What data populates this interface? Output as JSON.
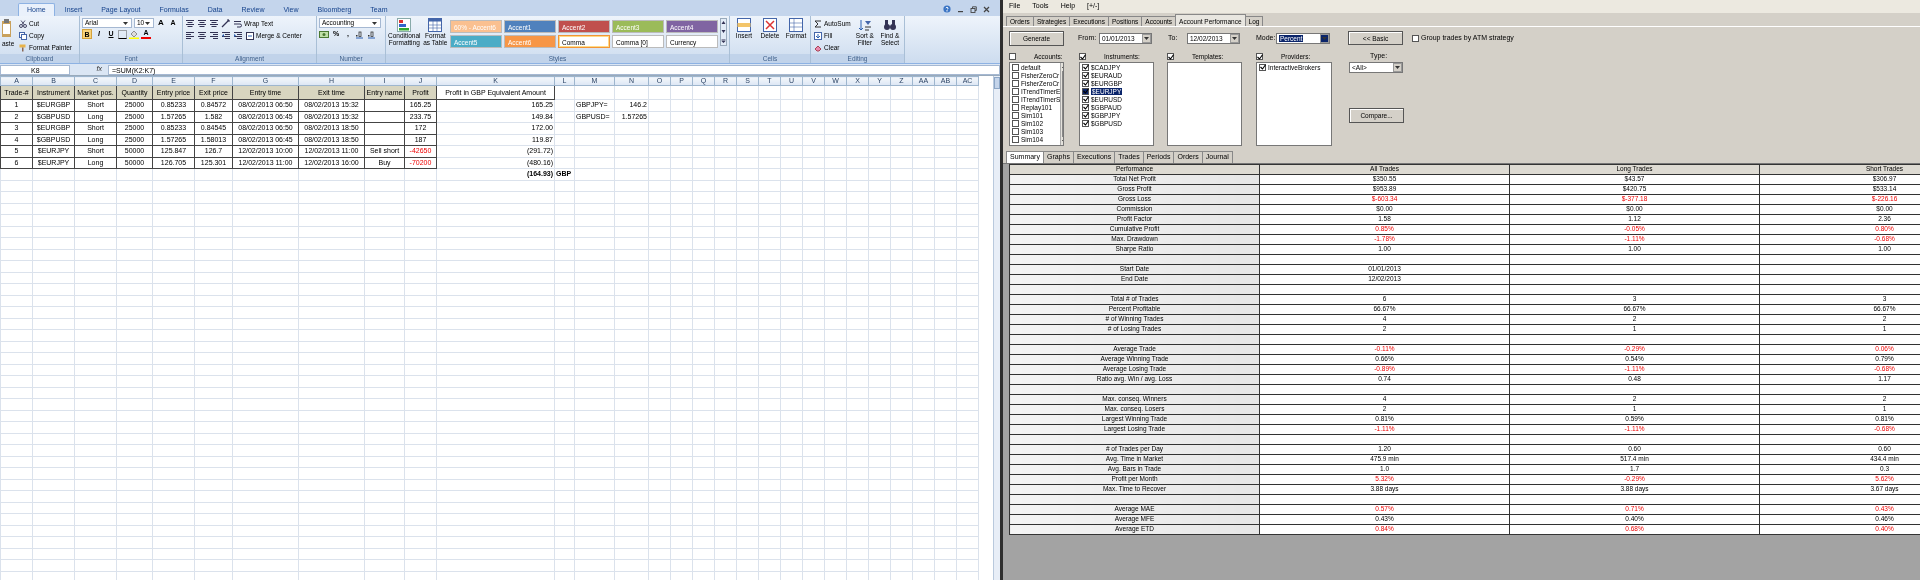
{
  "excel": {
    "ribbon_tabs": [
      {
        "label": "Home",
        "selected": true
      },
      {
        "label": "Insert",
        "selected": false
      },
      {
        "label": "Page Layout",
        "selected": false
      },
      {
        "label": "Formulas",
        "selected": false
      },
      {
        "label": "Data",
        "selected": false
      },
      {
        "label": "Review",
        "selected": false
      },
      {
        "label": "View",
        "selected": false
      },
      {
        "label": "Bloomberg",
        "selected": false
      },
      {
        "label": "Team",
        "selected": false
      }
    ],
    "clipboard": {
      "paste": "aste",
      "cut": "Cut",
      "copy": "Copy",
      "format_painter": "Format Painter",
      "label": "Clipboard"
    },
    "font": {
      "name": "Arial",
      "size": "10",
      "grow": "A",
      "shrink": "A",
      "bold": "B",
      "italic": "I",
      "underline": "U",
      "font_color": "A",
      "label": "Font"
    },
    "alignment": {
      "wrap": "Wrap Text",
      "merge": "Merge & Center",
      "label": "Alignment"
    },
    "number": {
      "format": "Accounting",
      "percent": "%",
      "comma": ",",
      "label": "Number"
    },
    "styles": {
      "conditional": "Conditional Formatting",
      "format_table": "Format as Table",
      "label": "Styles",
      "cells": [
        {
          "label": "60% - Accent6",
          "color": "#fac090",
          "kind": "accent",
          "selected": false
        },
        {
          "label": "Accent1",
          "color": "#4f81bd",
          "kind": "accent",
          "selected": false
        },
        {
          "label": "Accent2",
          "color": "#c0504d",
          "kind": "accent",
          "selected": false
        },
        {
          "label": "Accent3",
          "color": "#9bbb59",
          "kind": "accent",
          "selected": false
        },
        {
          "label": "Accent4",
          "color": "#8064a2",
          "kind": "accent",
          "selected": false
        },
        {
          "label": "Accent5",
          "color": "#4bacc6",
          "kind": "accent",
          "selected": false
        },
        {
          "label": "Accent6",
          "color": "#f79646",
          "kind": "accent",
          "selected": false
        },
        {
          "label": "Comma",
          "color": "#ffffff",
          "kind": "plain",
          "selected": true
        },
        {
          "label": "Comma [0]",
          "color": "#ffffff",
          "kind": "plain",
          "selected": false
        },
        {
          "label": "Currency",
          "color": "#ffffff",
          "kind": "plain",
          "selected": false
        }
      ]
    },
    "cells_group": {
      "buttons": [
        "Insert",
        "Delete",
        "Format"
      ],
      "label": "Cells"
    },
    "editing": {
      "autosum": "AutoSum",
      "fill": "Fill",
      "clear": "Clear",
      "sort": "Sort & Filter",
      "find": "Find & Select",
      "label": "Editing"
    },
    "name_box": "K8",
    "fx": "fx",
    "formula": "=SUM(K2:K7)",
    "columns": [
      "A",
      "B",
      "C",
      "D",
      "E",
      "F",
      "G",
      "H",
      "I",
      "J",
      "K",
      "L",
      "M",
      "N",
      "O",
      "P",
      "Q",
      "R",
      "S",
      "T",
      "U",
      "V",
      "W",
      "X",
      "Y",
      "Z",
      "AA",
      "AB",
      "AC"
    ],
    "trade_headers": [
      "Trade-#",
      "Instrument",
      "Market pos.",
      "Quantity",
      "Entry price",
      "Exit price",
      "Entry time",
      "Exit time",
      "Entry name",
      "Profit"
    ],
    "trades": [
      {
        "cells": [
          "1",
          "$EURGBP",
          "Short",
          "25000",
          "0.85233",
          "0.84572",
          "08/02/2013 06:50",
          "08/02/2013 15:32"
        ],
        "profit": "165.25",
        "loss": false
      },
      {
        "cells": [
          "2",
          "$GBPUSD",
          "Long",
          "25000",
          "1.57265",
          "1.582",
          "08/02/2013 06:45",
          "08/02/2013 15:32"
        ],
        "profit": "233.75",
        "loss": false
      },
      {
        "cells": [
          "3",
          "$EURGBP",
          "Short",
          "25000",
          "0.85233",
          "0.84545",
          "08/02/2013 06:50",
          "08/02/2013 18:50"
        ],
        "profit": "172",
        "loss": false
      },
      {
        "cells": [
          "4",
          "$GBPUSD",
          "Long",
          "25000",
          "1.57265",
          "1.58013",
          "08/02/2013 06:45",
          "08/02/2013 18:50"
        ],
        "profit": "187",
        "loss": false
      },
      {
        "cells": [
          "5",
          "$EURJPY",
          "Short",
          "50000",
          "125.847",
          "126.7",
          "12/02/2013 10:00",
          "12/02/2013 11:00"
        ],
        "entry_name": "Sell short",
        "profit": "-42650",
        "loss": true
      },
      {
        "cells": [
          "6",
          "$EURJPY",
          "Long",
          "50000",
          "126.705",
          "125.301",
          "12/02/2013 11:00",
          "12/02/2013 16:00"
        ],
        "entry_name": "Buy",
        "profit": "-70200",
        "loss": true
      }
    ],
    "gbp": {
      "header": "Profit in GBP Equivalent Amount",
      "values": [
        "165.25",
        "149.84",
        "172.00",
        "119.87",
        "(291.72)",
        "(480.16)"
      ],
      "total": "(164.93)",
      "currency": "GBP"
    },
    "rates": [
      {
        "label": "GBPJPY=",
        "value": "146.2"
      },
      {
        "label": "GBPUSD=",
        "value": "1.57265"
      }
    ]
  },
  "ninja": {
    "menu": [
      "File",
      "Tools",
      "Help",
      "[+/-]"
    ],
    "tabs": [
      {
        "label": "Orders",
        "selected": false
      },
      {
        "label": "Strategies",
        "selected": false
      },
      {
        "label": "Executions",
        "selected": false
      },
      {
        "label": "Positions",
        "selected": false
      },
      {
        "label": "Accounts",
        "selected": false
      },
      {
        "label": "Account Performance",
        "selected": true
      },
      {
        "label": "Log",
        "selected": false
      }
    ],
    "generate": "Generate",
    "from_label": "From:",
    "from": "01/01/2013",
    "to_label": "To:",
    "to": "12/02/2013",
    "mode_label": "Mode:",
    "mode": "Percent",
    "basic": "<< Basic",
    "group_atm": {
      "label": "Group trades by ATM strategy",
      "checked": false
    },
    "lists": [
      {
        "title": "Accounts:",
        "checked": false,
        "items": [
          {
            "label": "default",
            "checked": false,
            "selected": false
          },
          {
            "label": "FisherZeroCr",
            "checked": false,
            "selected": false
          },
          {
            "label": "FisherZeroCr",
            "checked": false,
            "selected": false
          },
          {
            "label": "ITrendTimerE",
            "checked": false,
            "selected": false
          },
          {
            "label": "ITrendTimerS",
            "checked": false,
            "selected": false
          },
          {
            "label": "Replay101",
            "checked": false,
            "selected": false
          },
          {
            "label": "Sim101",
            "checked": false,
            "selected": false
          },
          {
            "label": "Sim102",
            "checked": false,
            "selected": false
          },
          {
            "label": "Sim103",
            "checked": false,
            "selected": false
          },
          {
            "label": "Sim104",
            "checked": false,
            "selected": false
          }
        ]
      },
      {
        "title": "Instruments:",
        "checked": true,
        "items": [
          {
            "label": "$CADJPY",
            "checked": true,
            "selected": false
          },
          {
            "label": "$EURAUD",
            "checked": true,
            "selected": false
          },
          {
            "label": "$EURGBP",
            "checked": true,
            "selected": false
          },
          {
            "label": "$EURJPY",
            "checked": true,
            "selected": true
          },
          {
            "label": "$EURUSD",
            "checked": true,
            "selected": false
          },
          {
            "label": "$GBPAUD",
            "checked": true,
            "selected": false
          },
          {
            "label": "$GBPJPY",
            "checked": true,
            "selected": false
          },
          {
            "label": "$GBPUSD",
            "checked": true,
            "selected": false
          }
        ]
      },
      {
        "title": "Templates:",
        "checked": true
      },
      {
        "title": "Providers:",
        "checked": true,
        "items": [
          {
            "label": "InteractiveBrokers",
            "checked": true,
            "selected": false
          }
        ]
      }
    ],
    "type_label": "Type:",
    "type": "<All>",
    "compare": "Compare...",
    "subtabs": [
      {
        "label": "Summary",
        "selected": true
      },
      {
        "label": "Graphs",
        "selected": false
      },
      {
        "label": "Executions",
        "selected": false
      },
      {
        "label": "Trades",
        "selected": false
      },
      {
        "label": "Periods",
        "selected": false
      },
      {
        "label": "Orders",
        "selected": false
      },
      {
        "label": "Journal",
        "selected": false
      }
    ],
    "table": {
      "columns": [
        "Performance",
        "All Trades",
        "Long Trades",
        "Short Trades"
      ],
      "rows": [
        {
          "kind": "metric",
          "label": "Total Net Profit",
          "values": [
            {
              "text": "$350.55",
              "flagged": false
            },
            {
              "text": "$43.57",
              "flagged": false
            },
            {
              "text": "$306.97",
              "flagged": false
            }
          ]
        },
        {
          "kind": "metric",
          "label": "Gross Profit",
          "values": [
            {
              "text": "$953.89",
              "flagged": false
            },
            {
              "text": "$420.75",
              "flagged": false
            },
            {
              "text": "$533.14",
              "flagged": false
            }
          ]
        },
        {
          "kind": "metric",
          "label": "Gross Loss",
          "values": [
            {
              "text": "$-603.34",
              "flagged": true
            },
            {
              "text": "$-377.18",
              "flagged": true
            },
            {
              "text": "$-226.16",
              "flagged": true
            }
          ]
        },
        {
          "kind": "metric",
          "label": "Commission",
          "values": [
            {
              "text": "$0.00",
              "flagged": false
            },
            {
              "text": "$0.00",
              "flagged": false
            },
            {
              "text": "$0.00",
              "flagged": false
            }
          ]
        },
        {
          "kind": "metric",
          "label": "Profit Factor",
          "values": [
            {
              "text": "1.58",
              "flagged": false
            },
            {
              "text": "1.12",
              "flagged": false
            },
            {
              "text": "2.36",
              "flagged": false
            }
          ]
        },
        {
          "kind": "metric",
          "label": "Cumulative Profit",
          "values": [
            {
              "text": "0.85%",
              "flagged": true
            },
            {
              "text": "-0.05%",
              "flagged": true
            },
            {
              "text": "0.80%",
              "flagged": true
            }
          ]
        },
        {
          "kind": "metric",
          "label": "Max. Drawdown",
          "values": [
            {
              "text": "-1.78%",
              "flagged": true
            },
            {
              "text": "-1.11%",
              "flagged": true
            },
            {
              "text": "-0.68%",
              "flagged": true
            }
          ]
        },
        {
          "kind": "metric",
          "label": "Sharpe Ratio",
          "values": [
            {
              "text": "1.00",
              "flagged": false
            },
            {
              "text": "1.00",
              "flagged": false
            },
            {
              "text": "1.00",
              "flagged": false
            }
          ]
        },
        {
          "kind": "spacer"
        },
        {
          "kind": "metric",
          "label": "Start Date",
          "values": [
            {
              "text": "01/01/2013",
              "flagged": false
            }
          ]
        },
        {
          "kind": "metric",
          "label": "End Date",
          "values": [
            {
              "text": "12/02/2013",
              "flagged": false
            }
          ]
        },
        {
          "kind": "spacer"
        },
        {
          "kind": "metric",
          "label": "Total # of Trades",
          "values": [
            {
              "text": "6",
              "flagged": false
            },
            {
              "text": "3",
              "flagged": false
            },
            {
              "text": "3",
              "flagged": false
            }
          ]
        },
        {
          "kind": "metric",
          "label": "Percent Profitable",
          "values": [
            {
              "text": "66.67%",
              "flagged": false
            },
            {
              "text": "66.67%",
              "flagged": false
            },
            {
              "text": "66.67%",
              "flagged": false
            }
          ]
        },
        {
          "kind": "metric",
          "label": "# of Winning Trades",
          "values": [
            {
              "text": "4",
              "flagged": false
            },
            {
              "text": "2",
              "flagged": false
            },
            {
              "text": "2",
              "flagged": false
            }
          ]
        },
        {
          "kind": "metric",
          "label": "# of Losing Trades",
          "values": [
            {
              "text": "2",
              "flagged": false
            },
            {
              "text": "1",
              "flagged": false
            },
            {
              "text": "1",
              "flagged": false
            }
          ]
        },
        {
          "kind": "spacer"
        },
        {
          "kind": "metric",
          "label": "Average Trade",
          "values": [
            {
              "text": "-0.11%",
              "flagged": true
            },
            {
              "text": "-0.29%",
              "flagged": true
            },
            {
              "text": "0.06%",
              "flagged": true
            }
          ]
        },
        {
          "kind": "metric",
          "label": "Average Winning Trade",
          "values": [
            {
              "text": "0.66%",
              "flagged": false
            },
            {
              "text": "0.54%",
              "flagged": false
            },
            {
              "text": "0.79%",
              "flagged": false
            }
          ]
        },
        {
          "kind": "metric",
          "label": "Average Losing Trade",
          "values": [
            {
              "text": "-0.89%",
              "flagged": true
            },
            {
              "text": "-1.11%",
              "flagged": true
            },
            {
              "text": "-0.68%",
              "flagged": true
            }
          ]
        },
        {
          "kind": "metric",
          "label": "Ratio avg. Win / avg. Loss",
          "values": [
            {
              "text": "0.74",
              "flagged": false
            },
            {
              "text": "0.48",
              "flagged": false
            },
            {
              "text": "1.17",
              "flagged": false
            }
          ]
        },
        {
          "kind": "spacer"
        },
        {
          "kind": "metric",
          "label": "Max. conseq. Winners",
          "values": [
            {
              "text": "4",
              "flagged": false
            },
            {
              "text": "2",
              "flagged": false
            },
            {
              "text": "2",
              "flagged": false
            }
          ]
        },
        {
          "kind": "metric",
          "label": "Max. conseq. Losers",
          "values": [
            {
              "text": "2",
              "flagged": false
            },
            {
              "text": "1",
              "flagged": false
            },
            {
              "text": "1",
              "flagged": false
            }
          ]
        },
        {
          "kind": "metric",
          "label": "Largest Winning Trade",
          "values": [
            {
              "text": "0.81%",
              "flagged": false
            },
            {
              "text": "0.59%",
              "flagged": false
            },
            {
              "text": "0.81%",
              "flagged": false
            }
          ]
        },
        {
          "kind": "metric",
          "label": "Largest Losing Trade",
          "values": [
            {
              "text": "-1.11%",
              "flagged": true
            },
            {
              "text": "-1.11%",
              "flagged": true
            },
            {
              "text": "-0.68%",
              "flagged": true
            }
          ]
        },
        {
          "kind": "spacer"
        },
        {
          "kind": "metric",
          "label": "# of Trades per Day",
          "values": [
            {
              "text": "1.20",
              "flagged": false
            },
            {
              "text": "0.60",
              "flagged": false
            },
            {
              "text": "0.60",
              "flagged": false
            }
          ]
        },
        {
          "kind": "metric",
          "label": "Avg. Time in Market",
          "values": [
            {
              "text": "475.9 min",
              "flagged": false
            },
            {
              "text": "517.4 min",
              "flagged": false
            },
            {
              "text": "434.4 min",
              "flagged": false
            }
          ]
        },
        {
          "kind": "metric",
          "label": "Avg. Bars in Trade",
          "values": [
            {
              "text": "1.0",
              "flagged": false
            },
            {
              "text": "1.7",
              "flagged": false
            },
            {
              "text": "0.3",
              "flagged": false
            }
          ]
        },
        {
          "kind": "metric",
          "label": "Profit per Month",
          "values": [
            {
              "text": "5.32%",
              "flagged": true
            },
            {
              "text": "-0.29%",
              "flagged": true
            },
            {
              "text": "5.62%",
              "flagged": true
            }
          ]
        },
        {
          "kind": "metric",
          "label": "Max. Time to Recover",
          "values": [
            {
              "text": "3.88 days",
              "flagged": false
            },
            {
              "text": "3.88 days",
              "flagged": false
            },
            {
              "text": "3.67 days",
              "flagged": false
            }
          ]
        },
        {
          "kind": "spacer"
        },
        {
          "kind": "metric",
          "label": "Average MAE",
          "values": [
            {
              "text": "0.57%",
              "flagged": true
            },
            {
              "text": "0.71%",
              "flagged": true
            },
            {
              "text": "0.43%",
              "flagged": true
            }
          ]
        },
        {
          "kind": "metric",
          "label": "Average MFE",
          "values": [
            {
              "text": "0.43%",
              "flagged": false
            },
            {
              "text": "0.40%",
              "flagged": false
            },
            {
              "text": "0.46%",
              "flagged": false
            }
          ]
        },
        {
          "kind": "metric",
          "label": "Average ETD",
          "values": [
            {
              "text": "0.84%",
              "flagged": true
            },
            {
              "text": "0.68%",
              "flagged": true
            },
            {
              "text": "0.40%",
              "flagged": true
            }
          ]
        }
      ]
    }
  }
}
